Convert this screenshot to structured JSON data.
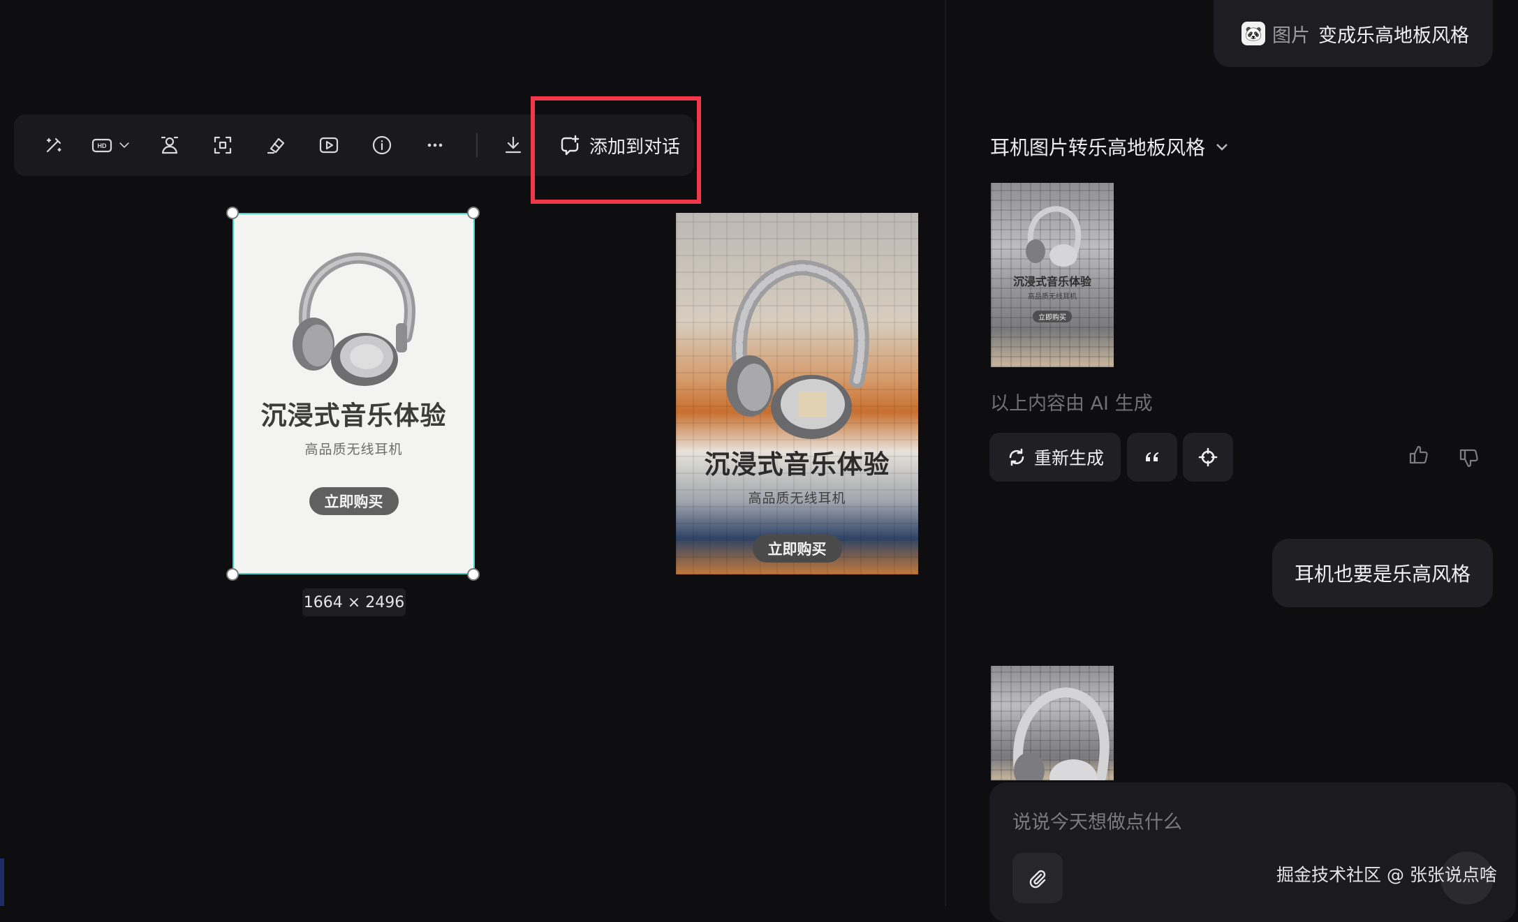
{
  "toolbar": {
    "hd_label": "HD",
    "add_to_chat_label": "添加到对话"
  },
  "canvas": {
    "original_poster": {
      "title": "沉浸式音乐体验",
      "subtitle": "高品质无线耳机",
      "cta": "立即购买"
    },
    "dimensions_label": "1664 × 2496",
    "lego_poster": {
      "title": "沉浸式音乐体验",
      "subtitle": "高品质无线耳机",
      "cta": "立即购买"
    }
  },
  "chat": {
    "top_message": {
      "tag": "图片",
      "text": "变成乐高地板风格"
    },
    "conversation_title": "耳机图片转乐高地板风格",
    "result_thumb": {
      "title": "沉浸式音乐体验",
      "subtitle": "高品质无线耳机",
      "cta": "立即购买"
    },
    "ai_note": "以上内容由 AI 生成",
    "regenerate_label": "重新生成",
    "user_message": "耳机也要是乐高风格",
    "composer_placeholder": "说说今天想做点什么"
  },
  "watermark": "掘金技术社区 @ 张张说点啥",
  "colors": {
    "background": "#0e0e10",
    "highlight": "#f0384a",
    "selection": "#4ad3c9"
  }
}
